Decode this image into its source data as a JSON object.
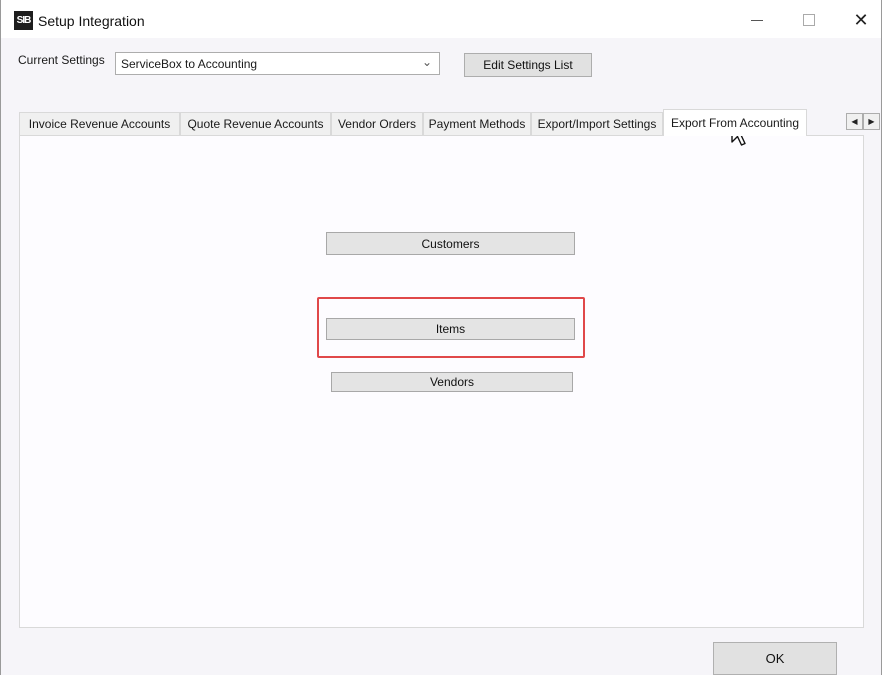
{
  "window": {
    "title": "Setup Integration",
    "icon": "SIB"
  },
  "settings": {
    "label": "Current Settings",
    "selected": "ServiceBox to Accounting",
    "edit_button": "Edit Settings List"
  },
  "tabs": [
    {
      "label": "Invoice Revenue Accounts"
    },
    {
      "label": "Quote Revenue Accounts"
    },
    {
      "label": "Vendor Orders"
    },
    {
      "label": "Payment Methods"
    },
    {
      "label": "Export/Import Settings"
    },
    {
      "label": "Export From Accounting",
      "active": true
    }
  ],
  "panel": {
    "customers_button": "Customers",
    "items_button": "Items",
    "vendors_button": "Vendors"
  },
  "footer": {
    "ok_button": "OK"
  },
  "colors": {
    "highlight": "#e0484a"
  },
  "icons": {
    "close": "close-icon",
    "minimize": "minimize-icon",
    "maximize": "maximize-icon",
    "dropdown": "chevron-down-icon",
    "tab_left": "arrow-left-icon",
    "tab_right": "arrow-right-icon",
    "pointer": "mouse-pointer-icon"
  }
}
